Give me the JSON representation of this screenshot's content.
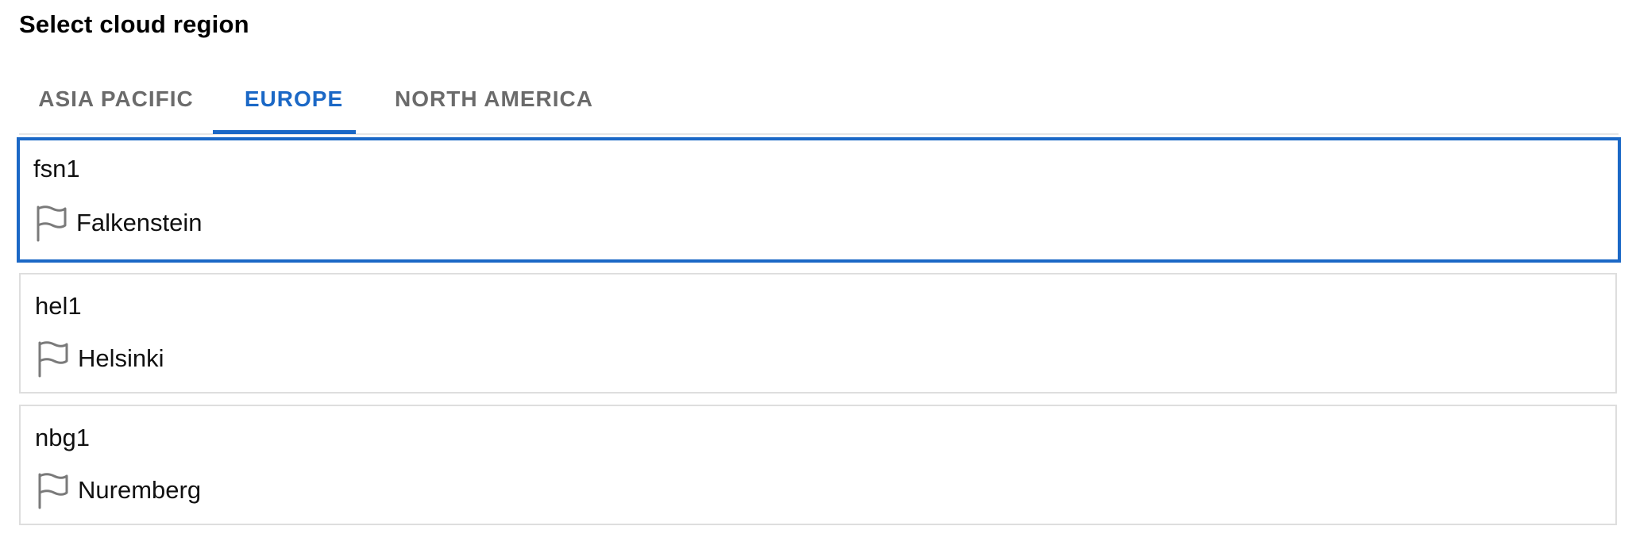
{
  "title": "Select cloud region",
  "tabs": [
    {
      "label": "ASIA PACIFIC",
      "selected": false
    },
    {
      "label": "EUROPE",
      "selected": true
    },
    {
      "label": "NORTH AMERICA",
      "selected": false
    }
  ],
  "regions": [
    {
      "code": "fsn1",
      "location": "Falkenstein",
      "icon": "flag-icon",
      "selected": true
    },
    {
      "code": "hel1",
      "location": "Helsinki",
      "icon": "flag-icon",
      "selected": false
    },
    {
      "code": "nbg1",
      "location": "Nuremberg",
      "icon": "flag-icon",
      "selected": false
    }
  ],
  "colors": {
    "accent": "#1b68c6",
    "tab_inactive": "#6b6b6b",
    "card_border": "#dedede",
    "text": "#111111"
  }
}
